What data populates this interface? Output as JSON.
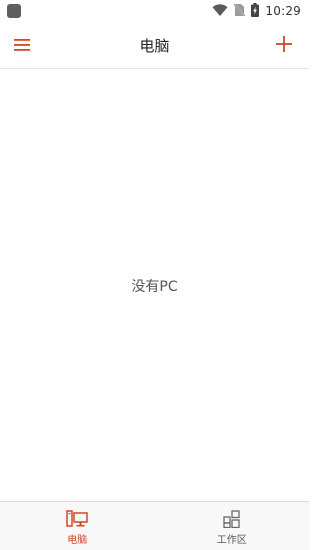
{
  "status_bar": {
    "time": "10:29",
    "icons": [
      "app-square-icon",
      "wifi-icon",
      "no-sim-icon",
      "battery-charging-icon"
    ]
  },
  "app_bar": {
    "title": "电脑",
    "left_icon": "menu-icon",
    "right_icon": "plus-icon"
  },
  "main": {
    "empty_message": "没有PC"
  },
  "bottom_nav": {
    "items": [
      {
        "label": "电脑",
        "icon": "pc-icon",
        "active": true
      },
      {
        "label": "工作区",
        "icon": "workspace-grid-icon",
        "active": false
      }
    ]
  },
  "colors": {
    "accent": "#d24726",
    "inactive": "#555555",
    "divider": "#e6e6e6"
  }
}
